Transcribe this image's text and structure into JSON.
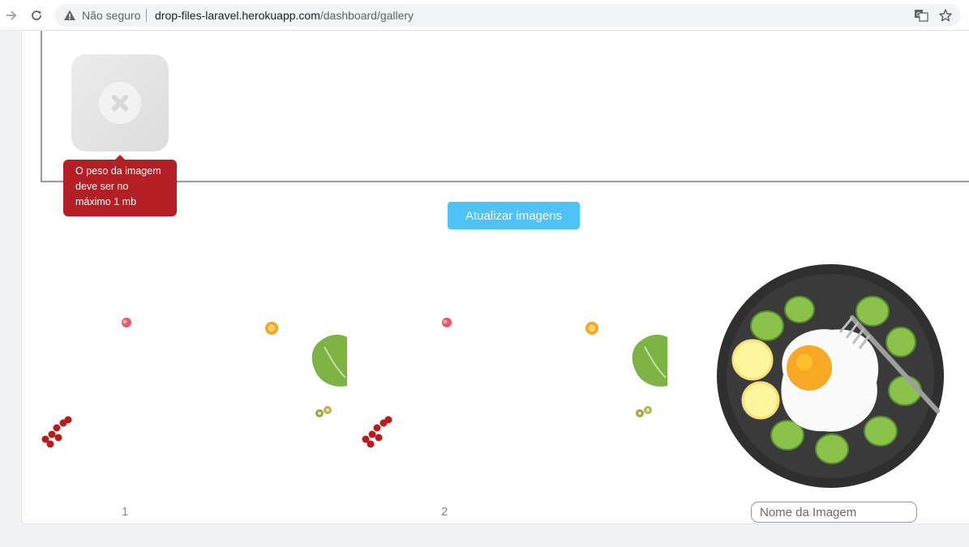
{
  "browser": {
    "security_label": "Não seguro",
    "url_host": "drop-files-laravel.herokuapp.com",
    "url_path": "/dashboard/gallery"
  },
  "dropzone": {
    "error_message": "O peso da imagem deve ser no máximo 1 mb"
  },
  "actions": {
    "update_label": "Atualizar imagens"
  },
  "gallery": {
    "items": [
      {
        "label": "1"
      },
      {
        "label": "2"
      }
    ],
    "name_placeholder": "Nome da Imagem"
  },
  "colors": {
    "accent": "#4fc3f7",
    "error": "#b31f24"
  }
}
